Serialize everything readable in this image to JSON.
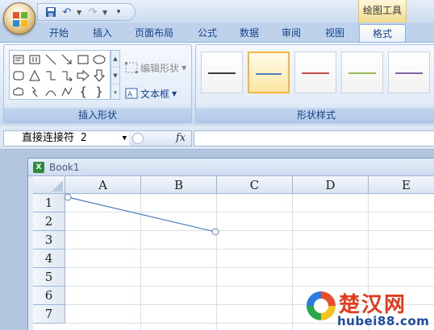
{
  "titlebar": {
    "contextual_tab_group": "绘图工具",
    "quick_access": {
      "save_icon": "save-icon",
      "undo_icon": "undo-icon",
      "redo_icon": "redo-icon"
    }
  },
  "tabs": [
    "开始",
    "插入",
    "页面布局",
    "公式",
    "数据",
    "审阅",
    "视图",
    "格式"
  ],
  "active_tab": "格式",
  "ribbon": {
    "insert_shapes": {
      "label": "插入形状",
      "edit_shape": "编辑形状",
      "edit_shape_disabled": true,
      "text_box": "文本框"
    },
    "shape_styles": {
      "label": "形状样式",
      "swatch_colors": [
        "#3a3a3a",
        "#4f81bd",
        "#c0504d",
        "#9bbb59",
        "#8064a2"
      ],
      "selected_index": 1
    }
  },
  "formula_bar": {
    "name_box": "直接连接符 2",
    "fx_label": "fx",
    "formula": ""
  },
  "workbook": {
    "title": "Book1",
    "columns": [
      "A",
      "B",
      "C",
      "D",
      "E"
    ],
    "rows": [
      "1",
      "2",
      "3",
      "4",
      "5",
      "6",
      "7"
    ]
  },
  "watermark": {
    "title": "楚汉网",
    "url": "hubei88.com"
  }
}
